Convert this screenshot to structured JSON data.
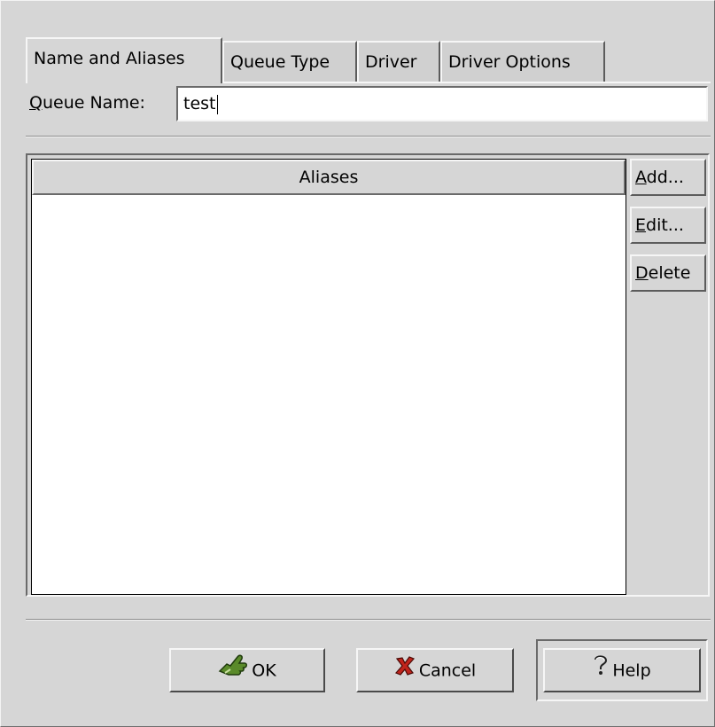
{
  "tabs": [
    {
      "label": "Name and Aliases",
      "active": true
    },
    {
      "label": "Queue Type",
      "active": false
    },
    {
      "label": "Driver",
      "active": false
    },
    {
      "label": "Driver Options",
      "active": false
    }
  ],
  "queue_name": {
    "label_mnemonic": "Q",
    "label_rest": "ueue Name:",
    "value": "test"
  },
  "aliases": {
    "header": "Aliases",
    "items": []
  },
  "side_buttons": {
    "add": {
      "mnemonic": "A",
      "rest": "dd..."
    },
    "edit": {
      "mnemonic": "E",
      "rest": "dit..."
    },
    "delete": {
      "mnemonic": "D",
      "rest": "elete"
    }
  },
  "bottom_buttons": {
    "ok": {
      "label": "OK",
      "icon": "ok-hand-icon"
    },
    "cancel": {
      "label": "Cancel",
      "icon": "cancel-x-icon"
    },
    "help": {
      "label": "Help",
      "icon": "help-question-icon"
    }
  },
  "colors": {
    "background": "#d6d6d6",
    "field": "#ffffff",
    "ok_icon": "#5a8a2a",
    "cancel_icon": "#c0241c"
  }
}
